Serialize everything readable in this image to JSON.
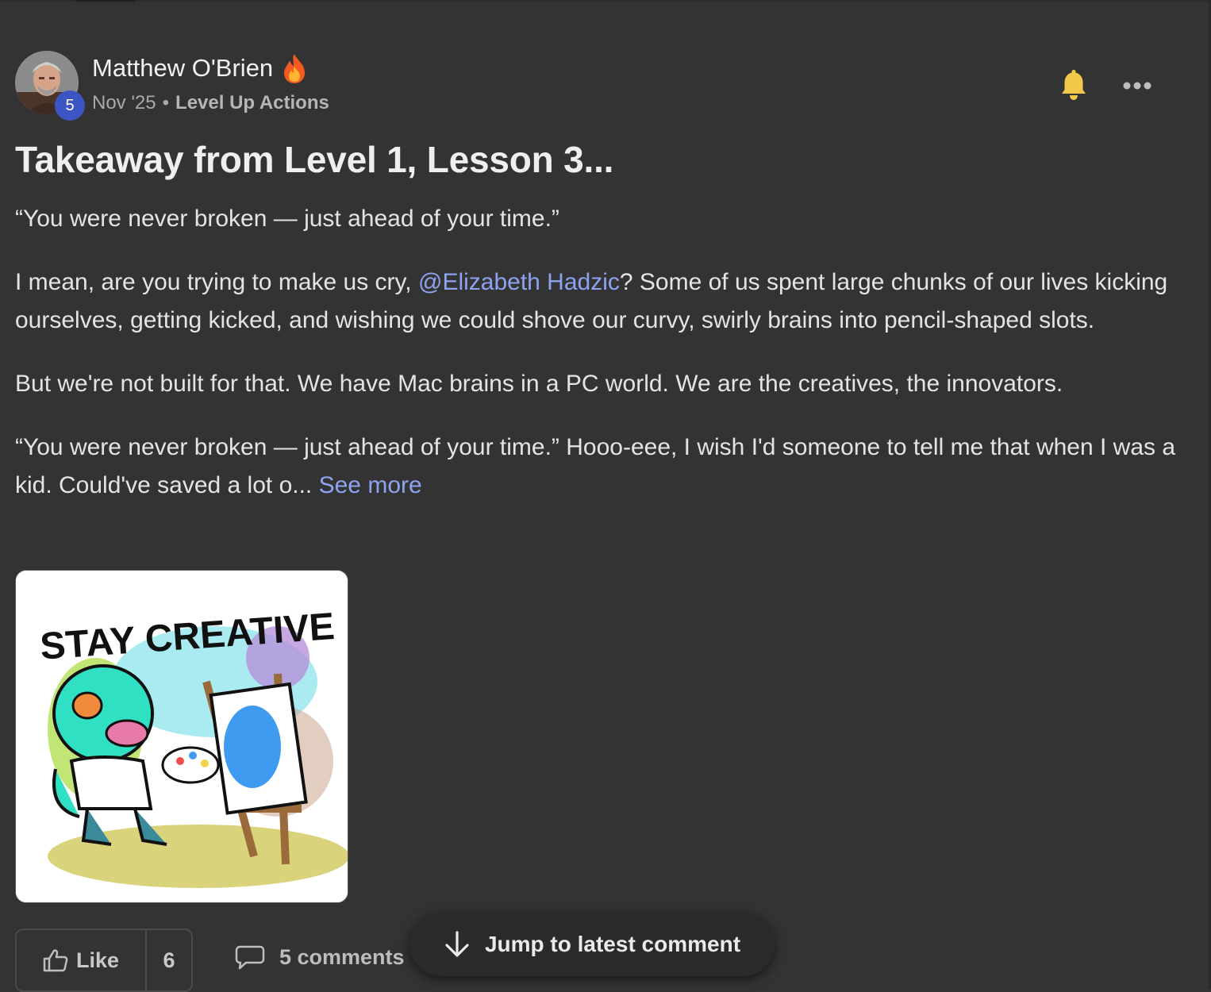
{
  "post": {
    "author": "Matthew O'Brien",
    "author_level": "5",
    "date": "Nov '25",
    "separator": "•",
    "category": "Level Up Actions",
    "title": "Takeaway from Level 1, Lesson 3...",
    "quote": "“You were never broken — just ahead of your time.”",
    "para2_before": "I mean, are you trying to make us cry, ",
    "mention": "@Elizabeth Hadzic",
    "para2_after": "? Some of us spent large chunks of our lives kicking ourselves, getting kicked, and wishing we could shove our curvy, swirly brains into pencil-shaped slots.",
    "para3": "But we're not built for that. We have Mac brains in a PC world. We are the creatives, the innovators.",
    "para4": "“You were never broken — just ahead of your time.” Hooo-eee, I wish I'd someone to tell me that when I was a kid. Could've saved a lot o... ",
    "see_more": "See more",
    "image_caption": "STAY CREATIVE"
  },
  "actions": {
    "like_label": "Like",
    "like_count": "6",
    "comments_label": "5 comments",
    "jump_label": "Jump to latest comment"
  },
  "icons": {
    "fire": "fire-icon",
    "bell": "bell-icon",
    "more": "more-horizontal-icon",
    "like": "thumbs-up-icon",
    "comment": "comment-icon",
    "arrow": "arrow-down-icon"
  },
  "colors": {
    "background": "#333333",
    "link": "#8ea3f0",
    "badge": "#3c55c4",
    "bell": "#f2c84b"
  }
}
